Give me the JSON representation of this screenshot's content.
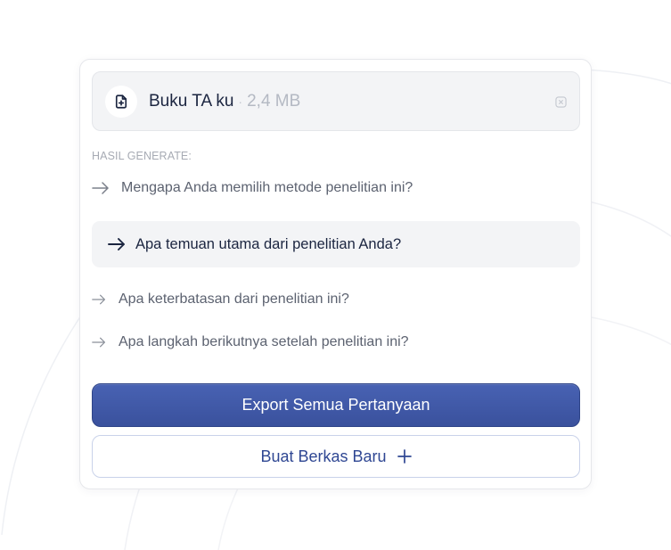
{
  "file": {
    "name": "Buku TA ku",
    "separator": "·",
    "size": "2,4 MB",
    "icon": "file-upload-icon",
    "close_icon": "close-icon"
  },
  "results": {
    "label": "HASIL GENERATE:",
    "questions": [
      {
        "text": "Mengapa Anda memilih metode penelitian ini?",
        "active": false
      },
      {
        "text": "Apa temuan utama dari penelitian Anda?",
        "active": true
      },
      {
        "text": "Apa keterbatasan dari penelitian ini?",
        "active": false
      },
      {
        "text": "Apa langkah berikutnya setelah penelitian ini?",
        "active": false
      }
    ]
  },
  "actions": {
    "export_label": "Export Semua Pertanyaan",
    "new_file_label": "Buat Berkas Baru",
    "new_file_icon": "plus-icon"
  },
  "colors": {
    "primary": "#3f58a8",
    "text_dark": "#1b2540",
    "text_muted": "#5c6270",
    "panel_bg": "#f3f4f6"
  }
}
